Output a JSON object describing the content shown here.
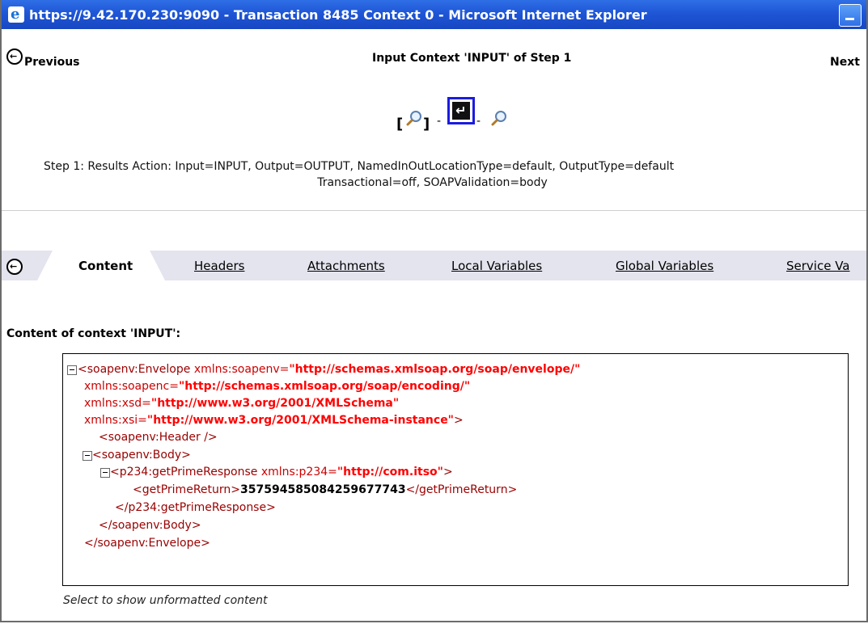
{
  "window": {
    "title": "https://9.42.170.230:9090 - Transaction 8485 Context 0 - Microsoft Internet Explorer",
    "app_icon": "ie-icon",
    "minimize_icon": "minimize-icon"
  },
  "nav": {
    "previous_label": "Previous",
    "context_title": "Input Context 'INPUT' of Step 1",
    "next_label": "Next"
  },
  "steps": {
    "open_bracket": "[",
    "close_bracket": "]",
    "dash": "-"
  },
  "step_description": {
    "line1": "Step 1: Results Action: Input=INPUT, Output=OUTPUT, NamedInOutLocationType=default, OutputType=default",
    "line2": "Transactional=off, SOAPValidation=body"
  },
  "tabs": [
    {
      "label": "Content",
      "active": true
    },
    {
      "label": "Headers",
      "active": false
    },
    {
      "label": "Attachments",
      "active": false
    },
    {
      "label": "Local Variables",
      "active": false
    },
    {
      "label": "Global Variables",
      "active": false
    },
    {
      "label": "Service Va",
      "active": false
    }
  ],
  "content_title": "Content of context 'INPUT':",
  "xml": {
    "envelope_open": "<soapenv:Envelope",
    "attr_soapenv": "xmlns:soapenv=",
    "val_soapenv": "\"http://schemas.xmlsoap.org/soap/envelope/\"",
    "attr_soapenc": "xmlns:soapenc=",
    "val_soapenc": "\"http://schemas.xmlsoap.org/soap/encoding/\"",
    "attr_xsd": "xmlns:xsd=",
    "val_xsd": "\"http://www.w3.org/2001/XMLSchema\"",
    "attr_xsi": "xmlns:xsi=",
    "val_xsi": "\"http://www.w3.org/2001/XMLSchema-instance\"",
    "close_gt": ">",
    "header": "<soapenv:Header />",
    "body_open": "<soapenv:Body>",
    "response_open": "<p234:getPrimeResponse",
    "attr_p234": "xmlns:p234=",
    "val_p234": "\"http://com.itso\"",
    "return_open": "<getPrimeReturn>",
    "return_value": "357594585084259677743",
    "return_close": "</getPrimeReturn>",
    "response_close": "</p234:getPrimeResponse>",
    "body_close": "</soapenv:Body>",
    "envelope_close": "</soapenv:Envelope>"
  },
  "unformatted_link": "Select to show unformatted content"
}
